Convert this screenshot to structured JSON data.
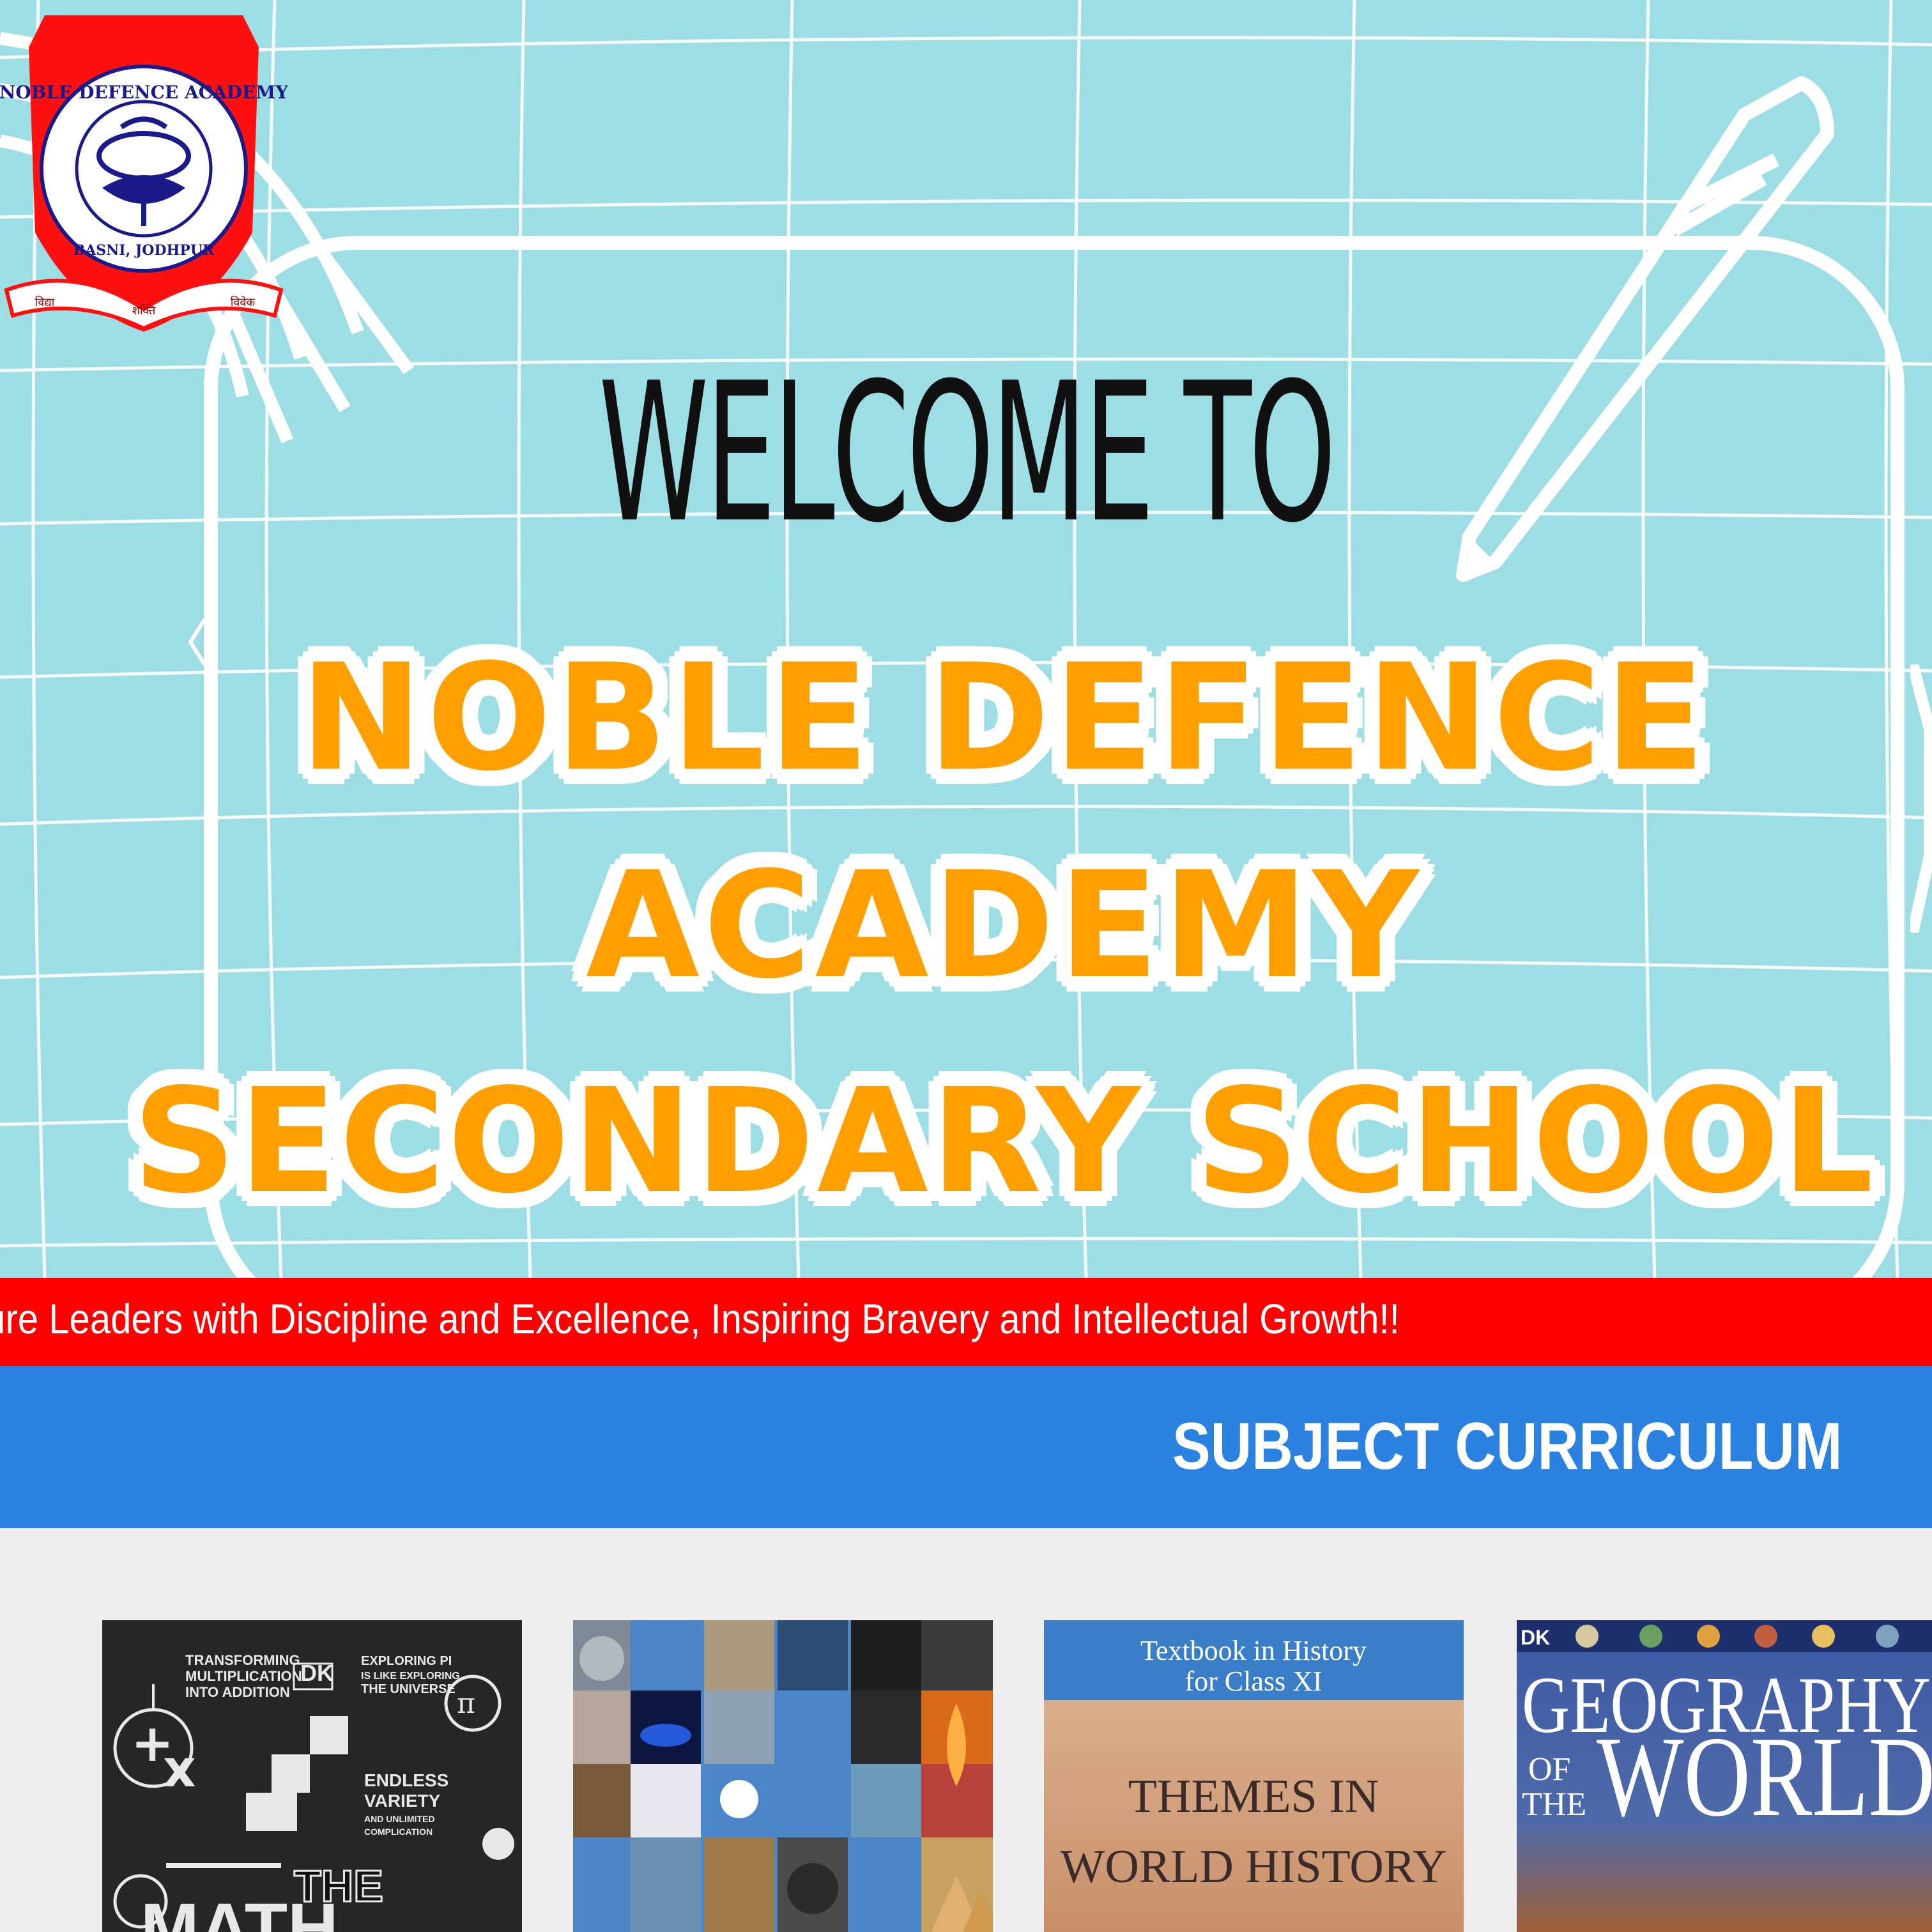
{
  "hero": {
    "welcome": "WELCOME TO",
    "title_lines": [
      "NOBLE DEFENCE",
      "ACADEMY",
      "SECONDARY SCHOOL"
    ],
    "logo": {
      "arc_text": "NOBLE DEFENCE ACADEMY",
      "bottom_text": "BASNI, JODHPUR",
      "ribbon": [
        "विद्या",
        "शक्ति",
        "विवेक"
      ]
    }
  },
  "ticker": {
    "text": "ture Leaders with Discipline and Excellence, Inspiring Bravery and Intellectual Growth!!"
  },
  "section": {
    "title": "SUBJECT CURRICULUM"
  },
  "books": [
    {
      "subject": "maths",
      "cover_lines": [
        "TRANSFORMING",
        "MULTIPLICATION",
        "INTO ADDITION",
        "DK",
        "EXPLORING PI",
        "IS LIKE EXPLORING",
        "THE UNIVERSE",
        "ENDLESS",
        "VARIETY",
        "AND UNLIMITED",
        "COMPLICATION",
        "THE",
        "MATH"
      ]
    },
    {
      "subject": "science",
      "cover_lines": []
    },
    {
      "subject": "history",
      "cover_lines": [
        "Textbook in History",
        "for Class XI",
        "THEMES IN",
        "WORLD HISTORY"
      ]
    },
    {
      "subject": "geography",
      "cover_lines": [
        "DK",
        "GEOGRAPHY",
        "OF",
        "THE",
        "WORLD"
      ]
    }
  ],
  "colors": {
    "hero_bg": "#9cdee3",
    "title_orange": "#ffa000",
    "ticker_red": "#ff0000",
    "section_blue": "#2a81e0",
    "page_bg": "#eeeeee"
  }
}
